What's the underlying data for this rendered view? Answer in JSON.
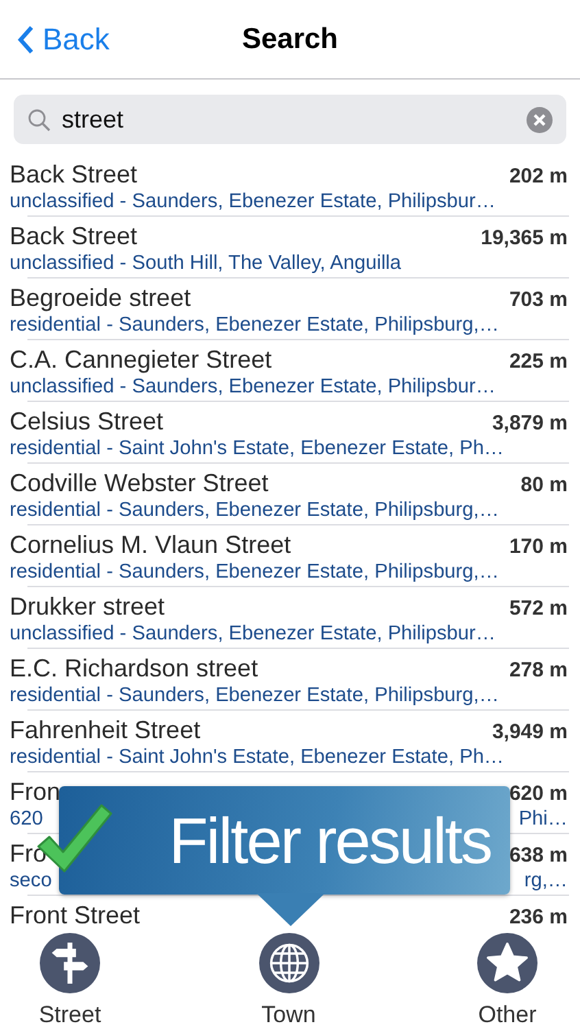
{
  "nav": {
    "back": "Back",
    "title": "Search"
  },
  "search": {
    "value": "street"
  },
  "results": [
    {
      "title": "Back Street",
      "distance": "202 m",
      "subtitle": "unclassified - Saunders, Ebenezer Estate, Philipsbur…"
    },
    {
      "title": "Back Street",
      "distance": "19,365 m",
      "subtitle": "unclassified - South Hill, The Valley, Anguilla"
    },
    {
      "title": "Begroeide street",
      "distance": "703 m",
      "subtitle": "residential - Saunders, Ebenezer Estate, Philipsburg,…"
    },
    {
      "title": "C.A. Cannegieter Street",
      "distance": "225 m",
      "subtitle": "unclassified - Saunders, Ebenezer Estate, Philipsbur…"
    },
    {
      "title": "Celsius Street",
      "distance": "3,879 m",
      "subtitle": "residential - Saint John's Estate, Ebenezer Estate, Ph…"
    },
    {
      "title": "Codville Webster Street",
      "distance": "80 m",
      "subtitle": "residential - Saunders, Ebenezer Estate, Philipsburg,…"
    },
    {
      "title": "Cornelius M. Vlaun Street",
      "distance": "170 m",
      "subtitle": "residential - Saunders, Ebenezer Estate, Philipsburg,…"
    },
    {
      "title": "Drukker street",
      "distance": "572 m",
      "subtitle": "unclassified - Saunders, Ebenezer Estate, Philipsbur…"
    },
    {
      "title": "E.C. Richardson street",
      "distance": "278 m",
      "subtitle": "residential - Saunders, Ebenezer Estate, Philipsburg,…"
    },
    {
      "title": "Fahrenheit Street",
      "distance": "3,949 m",
      "subtitle": "residential - Saint John's Estate, Ebenezer Estate, Ph…"
    },
    {
      "title": "Fron",
      "distance": "620 m",
      "subtitle": "620",
      "subtitle_end": "Phi…"
    },
    {
      "title": "Fro",
      "distance": "638 m",
      "subtitle": "seco",
      "subtitle_end": "rg,…"
    },
    {
      "title": "Front Street",
      "distance": "236 m"
    }
  ],
  "banner": {
    "text": "Filter results"
  },
  "tabs": [
    {
      "label": "Street",
      "kind": "street"
    },
    {
      "label": "Town",
      "kind": "town"
    },
    {
      "label": "Other",
      "kind": "other"
    }
  ]
}
